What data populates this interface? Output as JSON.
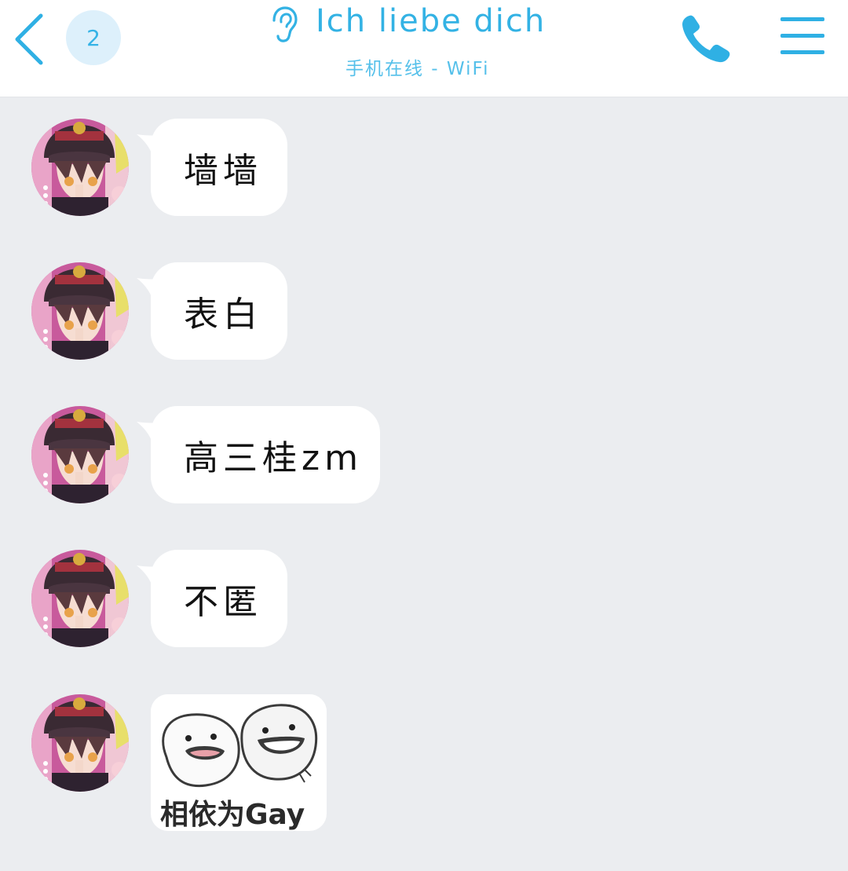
{
  "header": {
    "unread_count": "2",
    "title": "Ich liebe dich",
    "status": "手机在线 - WiFi",
    "accent_color": "#33b2e4"
  },
  "messages": [
    {
      "type": "text",
      "text": "墙墙"
    },
    {
      "type": "text",
      "text": "表白"
    },
    {
      "type": "text",
      "text": "高三桂zm"
    },
    {
      "type": "text",
      "text": "不匿"
    },
    {
      "type": "sticker",
      "caption": "相依为Gay"
    }
  ],
  "icons": {
    "back": "chevron-left-icon",
    "ear": "ear-icon",
    "phone": "phone-icon",
    "menu": "hamburger-menu-icon"
  }
}
